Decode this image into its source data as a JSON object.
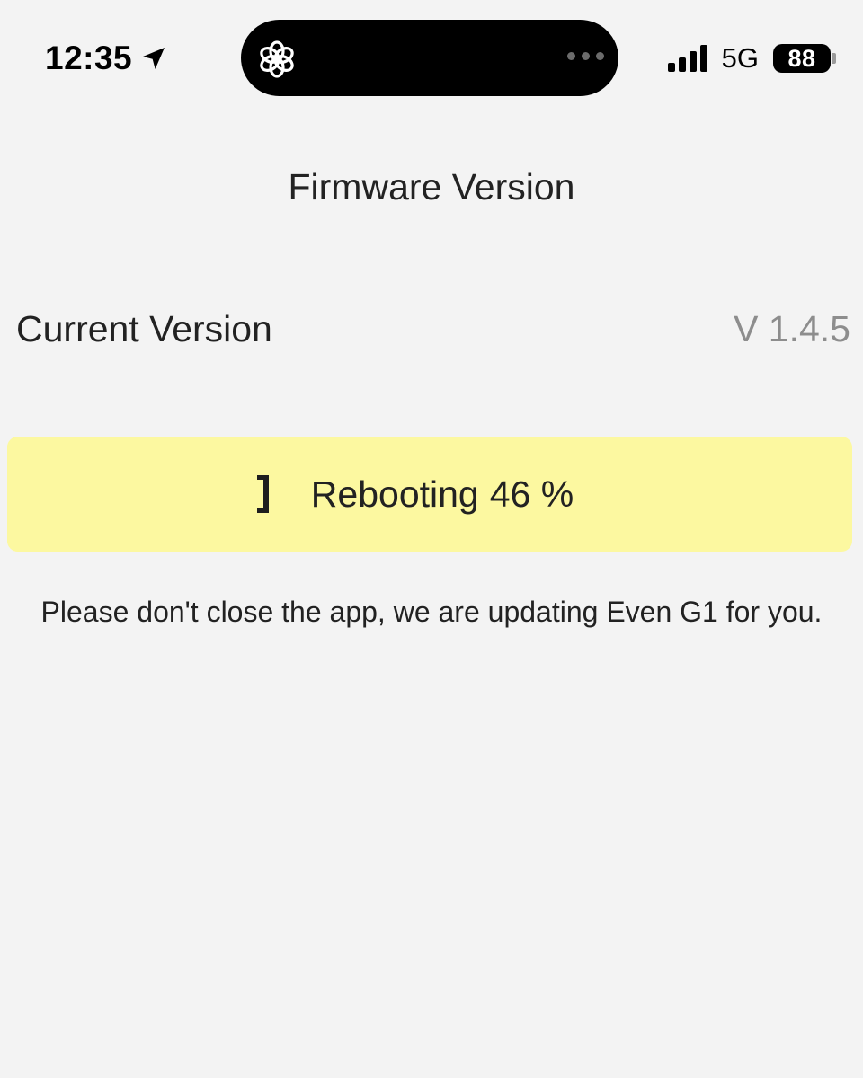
{
  "status_bar": {
    "time": "12:35",
    "location_icon": "location-arrow-icon",
    "app_icon": "openai-logo-icon",
    "network": "5G",
    "battery_level": "88",
    "signal_bars": 4
  },
  "page": {
    "title": "Firmware Version"
  },
  "version": {
    "label": "Current Version",
    "value": "V 1.4.5"
  },
  "progress": {
    "status_label": "Rebooting",
    "percent_text": "46 %",
    "percent": 46,
    "spinner_icon": "loading-spinner-icon",
    "accent_color": "#fcf8a0"
  },
  "notice": {
    "text": "Please don't close the app, we are updating Even G1 for you."
  }
}
